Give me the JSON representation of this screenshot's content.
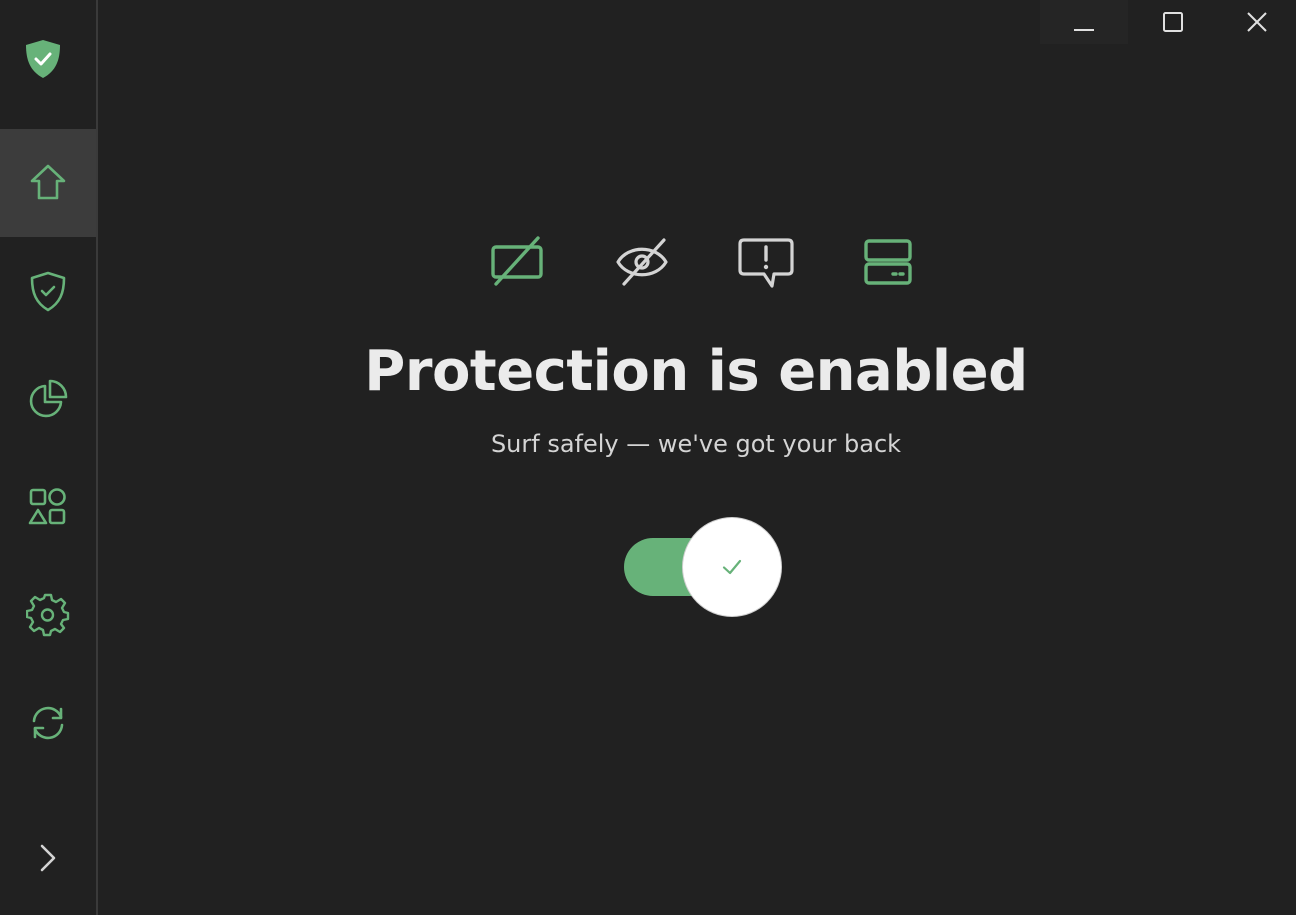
{
  "app": {
    "title": "Protection is enabled",
    "subtitle": "Surf safely — we've got your back"
  },
  "colors": {
    "accent": "#67b279",
    "background": "#212121",
    "sidebar_active": "#3c3c3c",
    "title_text": "#ebebeb",
    "subtitle_text": "#d4d4d4"
  },
  "sidebar": {
    "logo_icon": "shield-check-filled",
    "items": [
      {
        "id": "home",
        "icon": "home-icon",
        "active": true
      },
      {
        "id": "protection",
        "icon": "shield-check-icon",
        "active": false
      },
      {
        "id": "statistics",
        "icon": "pie-chart-icon",
        "active": false
      },
      {
        "id": "apps",
        "icon": "shapes-icon",
        "active": false
      },
      {
        "id": "settings",
        "icon": "gear-icon",
        "active": false
      },
      {
        "id": "updates",
        "icon": "refresh-icon",
        "active": false
      }
    ],
    "expand_icon": "chevron-right-icon"
  },
  "window_controls": [
    "minimize",
    "maximize",
    "close"
  ],
  "feature_icons": [
    {
      "name": "ad-blocking",
      "icon": "blocked-ad-icon",
      "color": "#67b279"
    },
    {
      "name": "tracking-protection",
      "icon": "eye-off-icon",
      "color": "#d4d4d4"
    },
    {
      "name": "annoyances",
      "icon": "alert-message-icon",
      "color": "#d4d4d4"
    },
    {
      "name": "dns-protection",
      "icon": "server-icon",
      "color": "#67b279"
    }
  ],
  "protection_toggle": {
    "enabled": true
  }
}
